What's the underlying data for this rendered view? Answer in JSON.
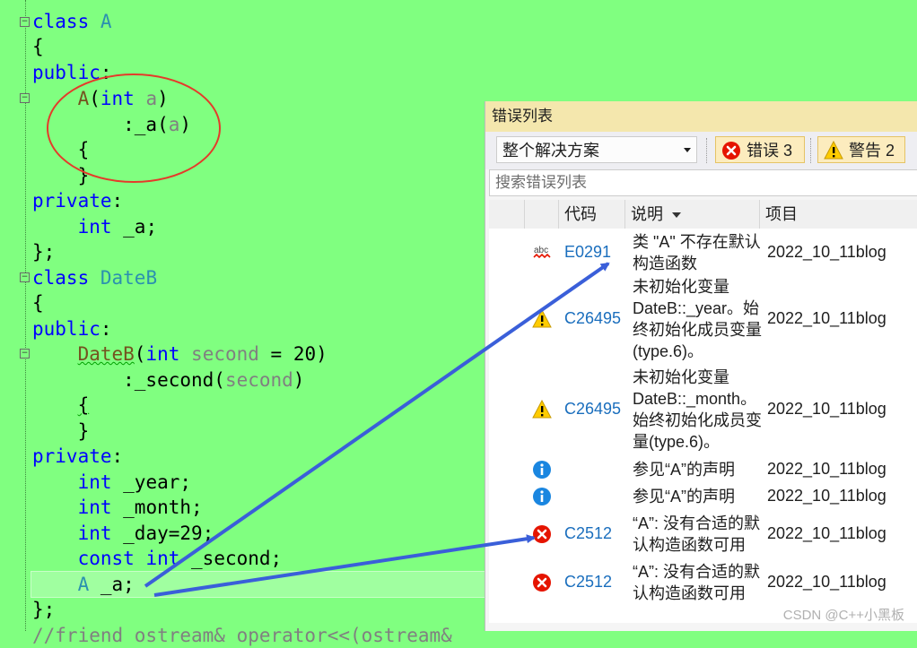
{
  "code_lines": [
    [
      {
        "t": "class",
        "c": "kw"
      },
      {
        "t": " "
      },
      {
        "t": "A",
        "c": "ty"
      }
    ],
    [
      {
        "t": "{"
      }
    ],
    [
      {
        "t": "public",
        "c": "kw"
      },
      {
        "t": ":"
      }
    ],
    [
      {
        "t": "    "
      },
      {
        "t": "A",
        "c": "fn"
      },
      {
        "t": "("
      },
      {
        "t": "int",
        "c": "kw"
      },
      {
        "t": " "
      },
      {
        "t": "a",
        "c": "pr"
      },
      {
        "t": ")"
      }
    ],
    [
      {
        "t": "        :_a("
      },
      {
        "t": "a",
        "c": "pr"
      },
      {
        "t": ")"
      }
    ],
    [
      {
        "t": "    {"
      }
    ],
    [
      {
        "t": "    }"
      }
    ],
    [
      {
        "t": "private",
        "c": "kw"
      },
      {
        "t": ":"
      }
    ],
    [
      {
        "t": "    "
      },
      {
        "t": "int",
        "c": "kw"
      },
      {
        "t": " _a;"
      }
    ],
    [
      {
        "t": "};"
      }
    ],
    [
      {
        "t": "class",
        "c": "kw"
      },
      {
        "t": " "
      },
      {
        "t": "DateB",
        "c": "ty"
      }
    ],
    [
      {
        "t": "{"
      }
    ],
    [
      {
        "t": "public",
        "c": "kw"
      },
      {
        "t": ":"
      }
    ],
    [
      {
        "t": "    "
      },
      {
        "t": "DateB",
        "c": "fn squig"
      },
      {
        "t": "("
      },
      {
        "t": "int",
        "c": "kw"
      },
      {
        "t": " "
      },
      {
        "t": "second",
        "c": "pr"
      },
      {
        "t": " = 20)"
      }
    ],
    [
      {
        "t": "        :_second("
      },
      {
        "t": "second",
        "c": "pr"
      },
      {
        "t": ")"
      }
    ],
    [
      {
        "t": "    "
      },
      {
        "t": "{",
        "c": "squig"
      }
    ],
    [
      {
        "t": "    }"
      }
    ],
    [
      {
        "t": "private",
        "c": "kw"
      },
      {
        "t": ":"
      }
    ],
    [
      {
        "t": "    "
      },
      {
        "t": "int",
        "c": "kw"
      },
      {
        "t": " _year;"
      }
    ],
    [
      {
        "t": "    "
      },
      {
        "t": "int",
        "c": "kw"
      },
      {
        "t": " _month;"
      }
    ],
    [
      {
        "t": "    "
      },
      {
        "t": "int",
        "c": "kw"
      },
      {
        "t": " _day=29;"
      }
    ],
    [
      {
        "t": "    "
      },
      {
        "t": "const",
        "c": "kw"
      },
      {
        "t": " "
      },
      {
        "t": "int",
        "c": "kw"
      },
      {
        "t": " _second;"
      }
    ],
    [
      {
        "t": "    "
      },
      {
        "t": "A",
        "c": "ty"
      },
      {
        "t": " _a;"
      }
    ],
    [
      {
        "t": "};"
      }
    ],
    [
      {
        "t": "//friend ostream& operator<<(ostream& ",
        "c": "pr"
      }
    ]
  ],
  "error_list": {
    "title": "错误列表",
    "scope_dropdown": "整个解决方案",
    "errors_button": "错误 3",
    "warnings_button": "警告 2",
    "search_placeholder": "搜索错误列表",
    "columns": {
      "code": "代码",
      "description": "说明",
      "project": "项目"
    },
    "rows": [
      {
        "icon": "abc-squiggle-icon",
        "code": "E0291",
        "description": "类 \"A\" 不存在默认构造函数",
        "project": "2022_10_11blog"
      },
      {
        "icon": "warning-icon",
        "code": "C26495",
        "description": "未初始化变量 DateB::_year。始终初始化成员变量(type.6)。",
        "project": "2022_10_11blog"
      },
      {
        "icon": "warning-icon",
        "code": "C26495",
        "description": "未初始化变量 DateB::_month。始终初始化成员变量(type.6)。",
        "project": "2022_10_11blog"
      },
      {
        "icon": "info-icon",
        "code": "",
        "description": "参见“A”的声明",
        "project": "2022_10_11blog"
      },
      {
        "icon": "info-icon",
        "code": "",
        "description": "参见“A”的声明",
        "project": "2022_10_11blog"
      },
      {
        "icon": "error-icon",
        "code": "C2512",
        "description": "“A”: 没有合适的默认构造函数可用",
        "project": "2022_10_11blog"
      },
      {
        "icon": "error-icon",
        "code": "C2512",
        "description": "“A”: 没有合适的默认构造函数可用",
        "project": "2022_10_11blog"
      }
    ]
  },
  "watermark": "CSDN @C++小黑板",
  "colors": {
    "editor_bg": "#80ff80",
    "keyword": "#0000ff",
    "type": "#2b91af",
    "annotation_red": "#e53a2a",
    "arrow_blue": "#3a5fd9"
  }
}
